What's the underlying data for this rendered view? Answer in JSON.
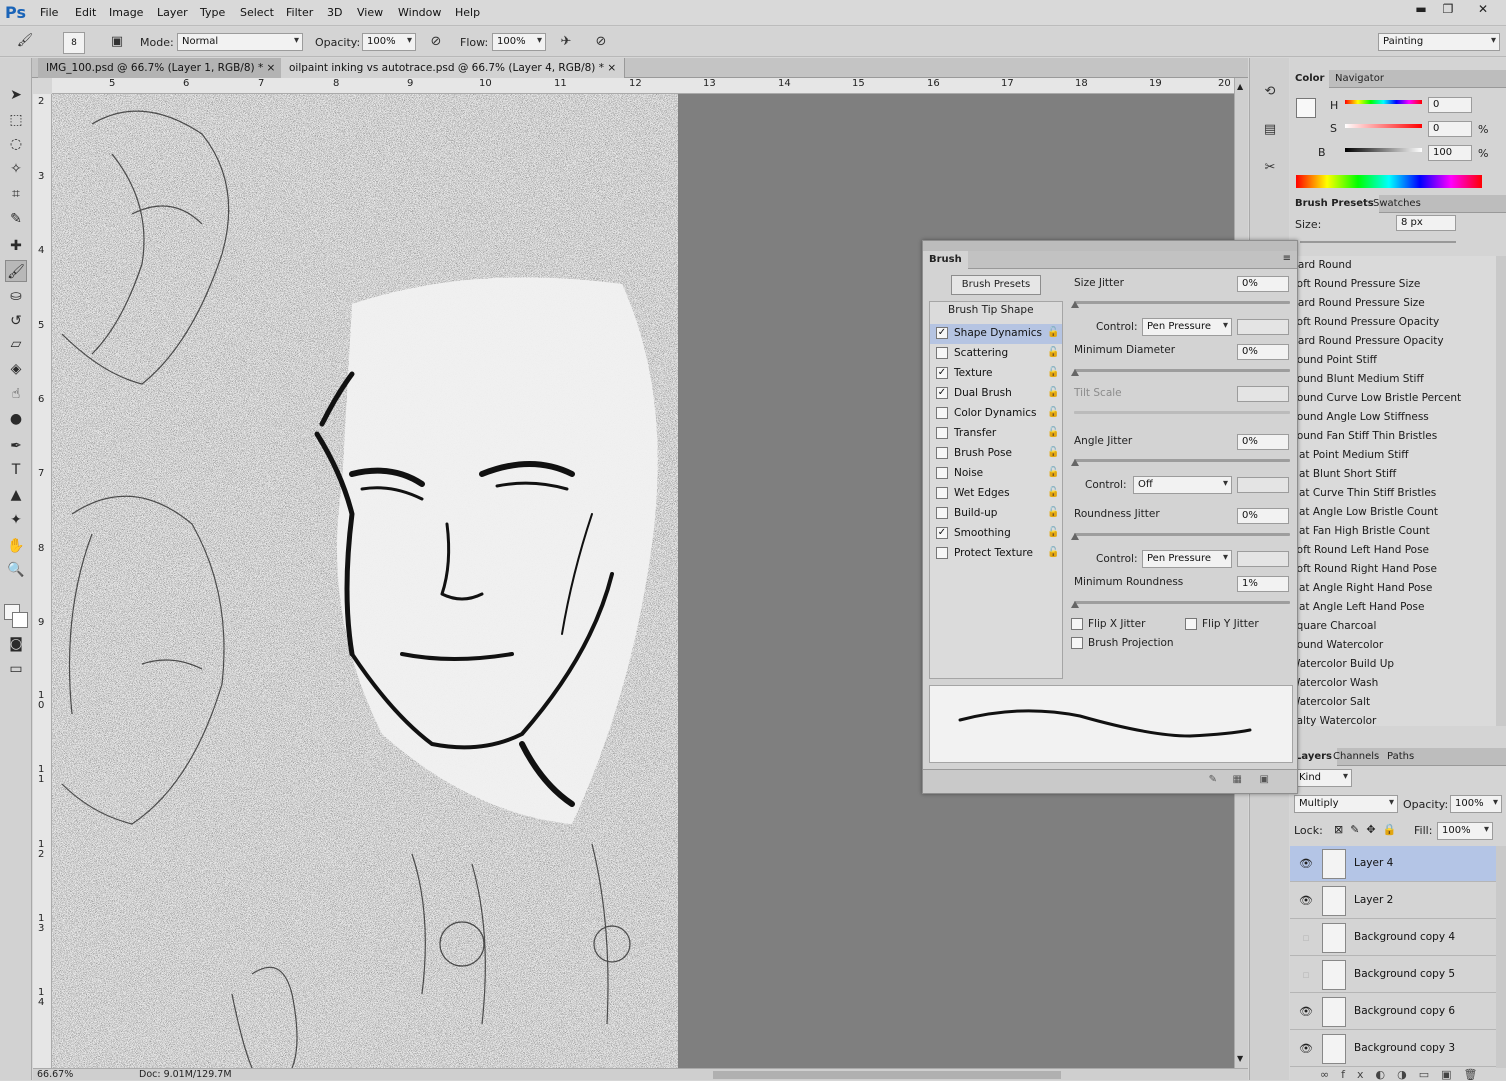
{
  "app": {
    "logo": "Ps"
  },
  "menu": [
    "File",
    "Edit",
    "Image",
    "Layer",
    "Type",
    "Select",
    "Filter",
    "3D",
    "View",
    "Window",
    "Help"
  ],
  "window_controls": {
    "minimize": "▬",
    "restore": "❐",
    "close": "✕"
  },
  "options_bar": {
    "brush_size": "8",
    "mode_label": "Mode:",
    "mode_value": "Normal",
    "opacity_label": "Opacity:",
    "opacity_value": "100%",
    "flow_label": "Flow:",
    "flow_value": "100%",
    "workspace": "Painting"
  },
  "doc_tabs": [
    {
      "title": "IMG_100.psd @ 66.7% (Layer 1, RGB/8) *",
      "close": "×"
    },
    {
      "title": "oilpaint inking vs autotrace.psd @ 66.7% (Layer 4, RGB/8) *",
      "close": "×"
    }
  ],
  "ruler_top": [
    "5",
    "6",
    "7",
    "8",
    "9",
    "10",
    "11",
    "12",
    "13",
    "14",
    "15",
    "16",
    "17",
    "18",
    "19",
    "20"
  ],
  "ruler_left": [
    "2",
    "3",
    "4",
    "5",
    "6",
    "7",
    "8",
    "9",
    "1 0",
    "1 1",
    "1 2",
    "1 3",
    "1 4"
  ],
  "status": {
    "zoom": "66.67%",
    "doc": "Doc: 9.01M/129.7M"
  },
  "color_panel": {
    "tabs": [
      "Color",
      "Navigator"
    ],
    "h_label": "H",
    "h_value": "0",
    "s_label": "S",
    "s_value": "0",
    "s_unit": "%",
    "b_label": "B",
    "b_value": "100",
    "b_unit": "%"
  },
  "presets_panel": {
    "tabs": [
      "Brush Presets",
      "Swatches"
    ],
    "size_label": "Size:",
    "size_value": "8 px",
    "items": [
      "Hard Round",
      "Soft Round Pressure Size",
      "Hard Round Pressure Size",
      "Soft Round Pressure Opacity",
      "Hard Round Pressure Opacity",
      "Round Point Stiff",
      "Round Blunt Medium Stiff",
      "Round Curve Low Bristle Percent",
      "Round Angle Low Stiffness",
      "Round Fan Stiff Thin Bristles",
      "Flat Point Medium Stiff",
      "Flat Blunt Short Stiff",
      "Flat Curve Thin Stiff Bristles",
      "Flat Angle Low Bristle Count",
      "Flat Fan High Bristle Count",
      "Soft Round Left Hand Pose",
      "Soft Round Right Hand Pose",
      "Flat Angle Right Hand Pose",
      "Flat Angle Left Hand Pose",
      "Square Charcoal",
      "Round Watercolor",
      "Watercolor Build Up",
      "Watercolor Wash",
      "Watercolor Salt",
      "Salty Watercolor"
    ]
  },
  "layers_panel": {
    "tabs": [
      "Layers",
      "Channels",
      "Paths"
    ],
    "filter_kind": "Kind",
    "blend_mode": "Multiply",
    "opacity_label": "Opacity:",
    "opacity_value": "100%",
    "lock_label": "Lock:",
    "fill_label": "Fill:",
    "fill_value": "100%",
    "layers": [
      {
        "name": "Layer 4",
        "visible": true,
        "selected": true
      },
      {
        "name": "Layer 2",
        "visible": true,
        "selected": false
      },
      {
        "name": "Background copy 4",
        "visible": false,
        "selected": false
      },
      {
        "name": "Background copy 5",
        "visible": false,
        "selected": false
      },
      {
        "name": "Background copy 6",
        "visible": true,
        "selected": false
      },
      {
        "name": "Background copy 3",
        "visible": true,
        "selected": false
      }
    ]
  },
  "brush_panel": {
    "title": "Brush",
    "presets_button": "Brush Presets",
    "tip_shape": "Brush Tip Shape",
    "options": [
      {
        "label": "Shape Dynamics",
        "checked": true,
        "active": true
      },
      {
        "label": "Scattering",
        "checked": false
      },
      {
        "label": "Texture",
        "checked": true
      },
      {
        "label": "Dual Brush",
        "checked": true
      },
      {
        "label": "Color Dynamics",
        "checked": false
      },
      {
        "label": "Transfer",
        "checked": false
      },
      {
        "label": "Brush Pose",
        "checked": false
      },
      {
        "label": "Noise",
        "checked": false
      },
      {
        "label": "Wet Edges",
        "checked": false
      },
      {
        "label": "Build-up",
        "checked": false
      },
      {
        "label": "Smoothing",
        "checked": true
      },
      {
        "label": "Protect Texture",
        "checked": false
      }
    ],
    "size_jitter_label": "Size Jitter",
    "size_jitter_value": "0%",
    "control_label": "Control:",
    "control1_value": "Pen Pressure",
    "min_diameter_label": "Minimum Diameter",
    "min_diameter_value": "0%",
    "tilt_scale_label": "Tilt Scale",
    "angle_jitter_label": "Angle Jitter",
    "angle_jitter_value": "0%",
    "control2_value": "Off",
    "roundness_jitter_label": "Roundness Jitter",
    "roundness_jitter_value": "0%",
    "control3_value": "Pen Pressure",
    "min_roundness_label": "Minimum Roundness",
    "min_roundness_value": "1%",
    "flip_x_label": "Flip X Jitter",
    "flip_y_label": "Flip Y Jitter",
    "brush_projection_label": "Brush Projection"
  }
}
